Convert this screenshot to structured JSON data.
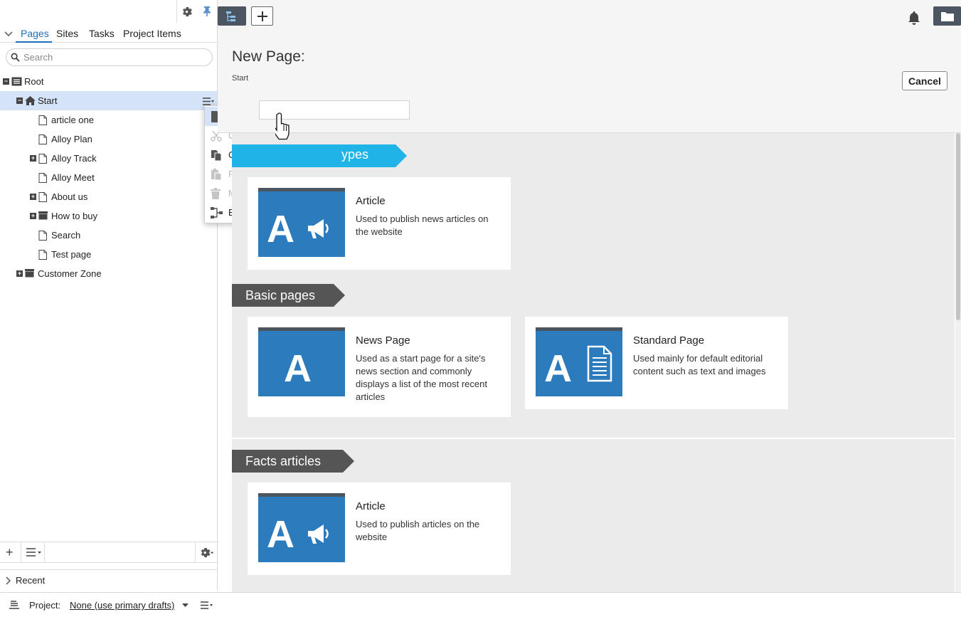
{
  "left_pane": {
    "tabs": [
      "Pages",
      "Sites",
      "Tasks",
      "Project Items"
    ],
    "search_placeholder": "Search",
    "tree": [
      {
        "label": "Root",
        "indent": 0,
        "expander": "minus",
        "icon": "root"
      },
      {
        "label": "Start",
        "indent": 1,
        "expander": "minus",
        "icon": "home",
        "selected": true
      },
      {
        "label": "article one",
        "indent": 2,
        "expander": "",
        "icon": "page"
      },
      {
        "label": "Alloy Plan",
        "indent": 2,
        "expander": "",
        "icon": "page"
      },
      {
        "label": "Alloy Track",
        "indent": 2,
        "expander": "plus",
        "icon": "page"
      },
      {
        "label": "Alloy Meet",
        "indent": 2,
        "expander": "",
        "icon": "page"
      },
      {
        "label": "About us",
        "indent": 2,
        "expander": "plus",
        "icon": "page"
      },
      {
        "label": "How to buy",
        "indent": 2,
        "expander": "plus",
        "icon": "container"
      },
      {
        "label": "Search",
        "indent": 2,
        "expander": "",
        "icon": "page"
      },
      {
        "label": "Test page",
        "indent": 2,
        "expander": "",
        "icon": "page"
      },
      {
        "label": "Customer Zone",
        "indent": 1,
        "expander": "plus",
        "icon": "container"
      }
    ],
    "recent_label": "Recent"
  },
  "context_menu": {
    "items": [
      {
        "label": "New Page",
        "disabled": false,
        "hover": true,
        "icon": "new-page-icon"
      },
      {
        "label": "Cut",
        "disabled": true,
        "icon": "cut-icon"
      },
      {
        "label": "Copy",
        "disabled": false,
        "icon": "copy-icon"
      },
      {
        "label": "Paste",
        "disabled": true,
        "icon": "paste-icon"
      },
      {
        "label": "Move to Trash",
        "disabled": true,
        "icon": "trash-icon"
      },
      {
        "label": "Edit Approval Sequence",
        "disabled": false,
        "icon": "approval-sequence-icon"
      }
    ]
  },
  "status_bar": {
    "project_label": "Project:",
    "project_value": "None (use primary drafts)"
  },
  "header": {
    "title": "New Page:",
    "breadcrumb": "Start",
    "cancel_label": "Cancel",
    "name_value": ""
  },
  "sections": [
    {
      "title": "Suggested Page Types",
      "visible_title": "ypes",
      "color": "#1fb3e8",
      "cards": [
        {
          "title": "Article",
          "desc": "Used to publish news articles on the website",
          "icon": "megaphone"
        }
      ]
    },
    {
      "title": "Basic pages",
      "color": "#555555",
      "cards": [
        {
          "title": "News Page",
          "desc": "Used as a start page for a site's news section and commonly displays a list of the most recent articles",
          "icon": "plain"
        },
        {
          "title": "Standard Page",
          "desc": "Used mainly for default editorial content such as text and images",
          "icon": "document"
        }
      ]
    },
    {
      "title": "Facts articles",
      "color": "#555555",
      "cards": [
        {
          "title": "Article",
          "desc": "Used to publish articles on the website",
          "icon": "megaphone"
        }
      ]
    }
  ],
  "colors": {
    "accent": "#1d6fb8",
    "selection": "#d5e3f8",
    "thumb_blue": "#2b7bbd",
    "suggested_banner": "#1fb3e8",
    "dark_banner": "#555555"
  }
}
